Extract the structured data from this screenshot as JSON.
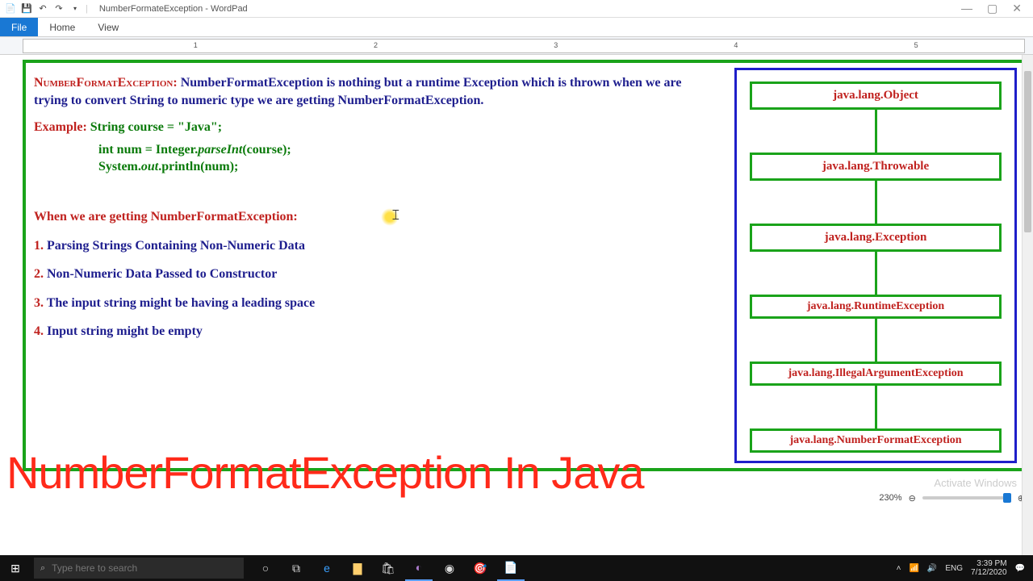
{
  "window": {
    "title": "NumberFormateException - WordPad"
  },
  "menu": {
    "file": "File",
    "home": "Home",
    "view": "View"
  },
  "ruler": [
    "1",
    "2",
    "3",
    "4",
    "5"
  ],
  "doc": {
    "heading1_label": "NumberFormatException:",
    "heading1_body": " NumberFormatException is nothing but a runtime Exception which is thrown when we are trying to convert String to numeric type we are getting NumberFormatException.",
    "example_label": "Example:",
    "code_line1": "  String course = \"Java\";",
    "code_line2a": "int num = Integer.",
    "code_line2b": "parseInt",
    "code_line2c": "(course);",
    "code_line3a": "System.",
    "code_line3b": "out",
    "code_line3c": ".println(num);",
    "when_label": "When we are getting NumberFormatException:",
    "pt1n": "1.",
    "pt1": " Parsing Strings Containing Non-Numeric Data",
    "pt2n": "2.",
    "pt2": " Non-Numeric Data Passed to Constructor",
    "pt3n": "3.",
    "pt3": " The input string might be having a leading space",
    "pt4n": "4.",
    "pt4": " Input string might be empty"
  },
  "hierarchy": [
    "java.lang.Object",
    "java.lang.Throwable",
    "java.lang.Exception",
    "java.lang.RuntimeException",
    "java.lang.IllegalArgumentException",
    "java.lang.NumberFormatException"
  ],
  "overlay": "NumberFormatException In Java",
  "activate": "Activate Windows",
  "statusbar": {
    "zoom": "230%"
  },
  "taskbar": {
    "search_placeholder": "Type here to search",
    "tray": {
      "net": "↑↓",
      "snd": "🔊",
      "lang": "ENG",
      "time": "3:39 PM",
      "date": "7/12/2020"
    }
  }
}
